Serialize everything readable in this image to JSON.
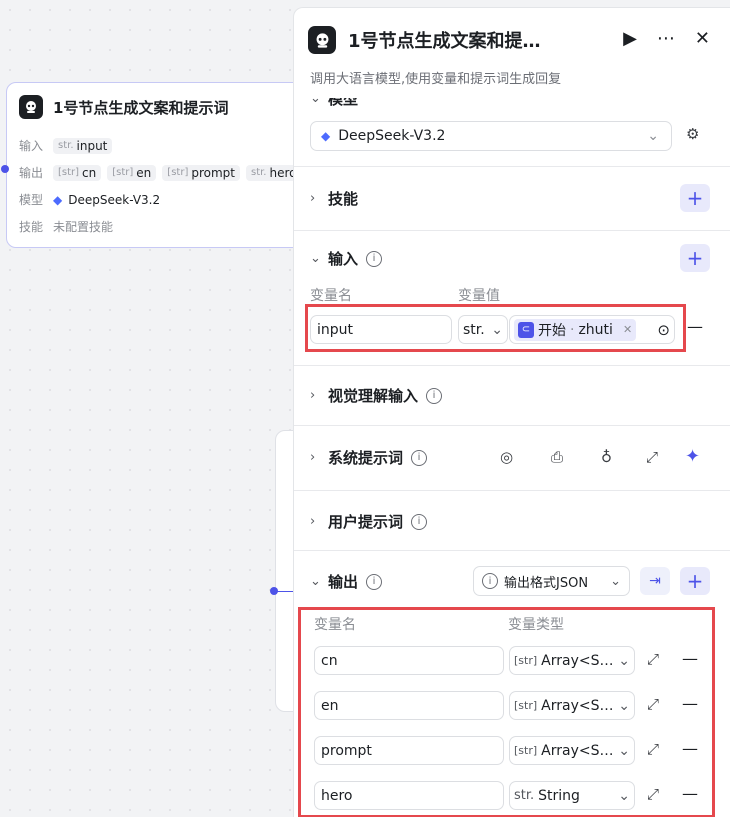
{
  "node_card": {
    "title": "1号节点生成文案和提示词",
    "input_label": "输入",
    "input_chip": {
      "type": "str.",
      "name": "input"
    },
    "output_label": "输出",
    "output_chips": [
      {
        "type": "[str]",
        "name": "cn"
      },
      {
        "type": "[str]",
        "name": "en"
      },
      {
        "type": "[str]",
        "name": "prompt"
      },
      {
        "type": "str.",
        "name": "hero"
      }
    ],
    "model_label": "模型",
    "model_name": "DeepSeek-V3.2",
    "skill_label": "技能",
    "skill_value": "未配置技能"
  },
  "panel": {
    "title": "1号节点生成文案和提…",
    "description": "调用大语言模型,使用变量和提示词生成回复",
    "model_section_partial": "模型",
    "model_select": "DeepSeek-V3.2",
    "sections": {
      "skills": "技能",
      "input": "输入",
      "vision": "视觉理解输入",
      "system_prompt": "系统提示词",
      "user_prompt": "用户提示词",
      "output": "输出"
    },
    "input_table": {
      "col_name": "变量名",
      "col_value": "变量值",
      "row": {
        "name": "input",
        "type": "str.",
        "ref_source": "开始",
        "ref_sep": " · ",
        "ref_var": "zhuti"
      }
    },
    "output_format": "输出格式JSON",
    "output_table": {
      "col_name": "变量名",
      "col_type": "变量类型",
      "rows": [
        {
          "name": "cn",
          "type_icon": "[str]",
          "type": "Array<S…"
        },
        {
          "name": "en",
          "type_icon": "[str]",
          "type": "Array<S…"
        },
        {
          "name": "prompt",
          "type_icon": "[str]",
          "type": "Array<S…"
        },
        {
          "name": "hero",
          "type_icon": "str.",
          "type": "String"
        }
      ]
    }
  },
  "colors": {
    "accent": "#4d53e8",
    "highlight": "#e5484d"
  }
}
